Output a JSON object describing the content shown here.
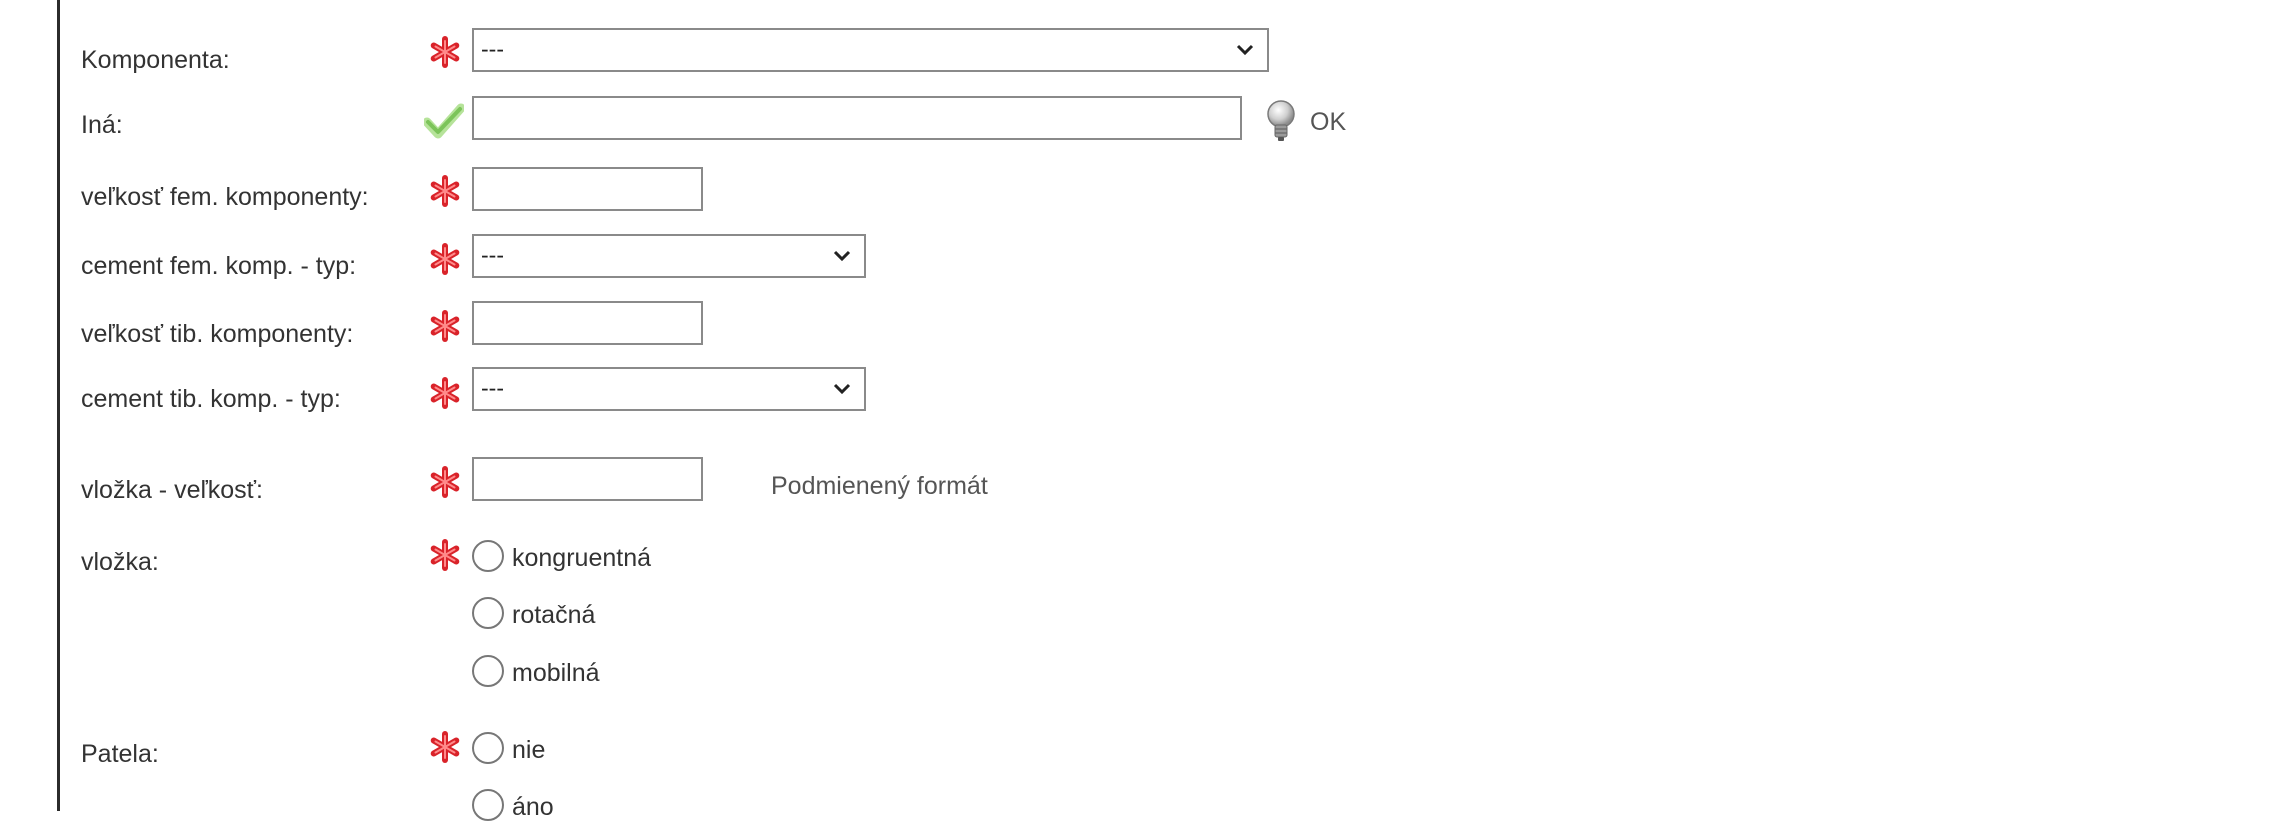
{
  "form": {
    "komponenta": {
      "label": "Komponenta:",
      "value": "---"
    },
    "ina": {
      "label": "Iná:",
      "value": "",
      "status": "OK"
    },
    "velkost_fem": {
      "label": "veľkosť fem. komponenty:",
      "value": ""
    },
    "cement_fem": {
      "label": "cement fem. komp. - typ:",
      "value": "---"
    },
    "velkost_tib": {
      "label": "veľkosť tib. komponenty:",
      "value": ""
    },
    "cement_tib": {
      "label": "cement tib. komp. - typ:",
      "value": "---"
    },
    "vlozka_velkost": {
      "label": "vložka - veľkosť:",
      "value": "",
      "note": "Podmienený formát"
    },
    "vlozka": {
      "label": "vložka:",
      "options": [
        "kongruentná",
        "rotačná",
        "mobilná"
      ]
    },
    "patela": {
      "label": "Patela:",
      "options": [
        "nie",
        "áno"
      ]
    }
  },
  "colors": {
    "required": "#d9232a",
    "valid": "#8fd16a",
    "border": "#8a8a8a"
  },
  "icons": {
    "required": "required-asterisk-icon",
    "valid": "checkmark-icon",
    "hint": "lightbulb-icon",
    "dropdown": "chevron-down-icon"
  }
}
